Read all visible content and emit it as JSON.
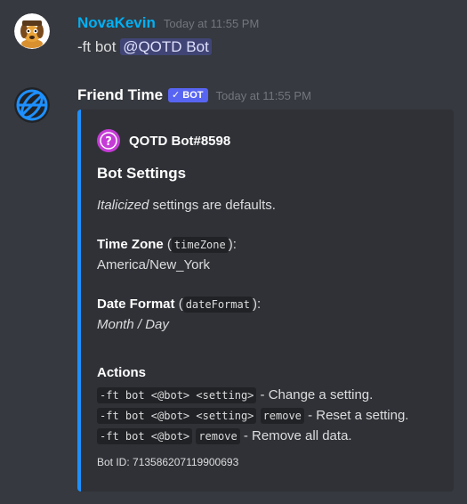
{
  "messages": [
    {
      "username": "NovaKevin",
      "username_color": "#00b0f4",
      "timestamp": "Today at 11:55 PM",
      "text_prefix": "-ft bot ",
      "mention": "@QOTD Bot"
    },
    {
      "username": "Friend Time",
      "username_color": "#ffffff",
      "bot_tag": "BOT",
      "timestamp": "Today at 11:55 PM",
      "embed": {
        "accent_color": "#1e90ff",
        "author_icon": "question-mark-icon",
        "author": "QOTD Bot#8598",
        "title": "Bot Settings",
        "intro_italic": "Italicized",
        "intro_rest": " settings are defaults.",
        "fields": [
          {
            "name": "Time Zone",
            "key": "timeZone",
            "value": "America/New_York",
            "italic": false
          },
          {
            "name": "Date Format",
            "key": "dateFormat",
            "value": "Month / Day",
            "italic": true
          }
        ],
        "actions_title": "Actions",
        "actions": [
          {
            "code1": "-ft bot <@bot> <setting>",
            "code2": "",
            "desc": " - Change a setting."
          },
          {
            "code1": "-ft bot <@bot> <setting>",
            "code2": "remove",
            "desc": " - Reset a setting."
          },
          {
            "code1": "-ft bot <@bot>",
            "code2": "remove",
            "desc": " - Remove all data."
          }
        ],
        "footer": "Bot ID: 713586207119900693"
      }
    }
  ]
}
